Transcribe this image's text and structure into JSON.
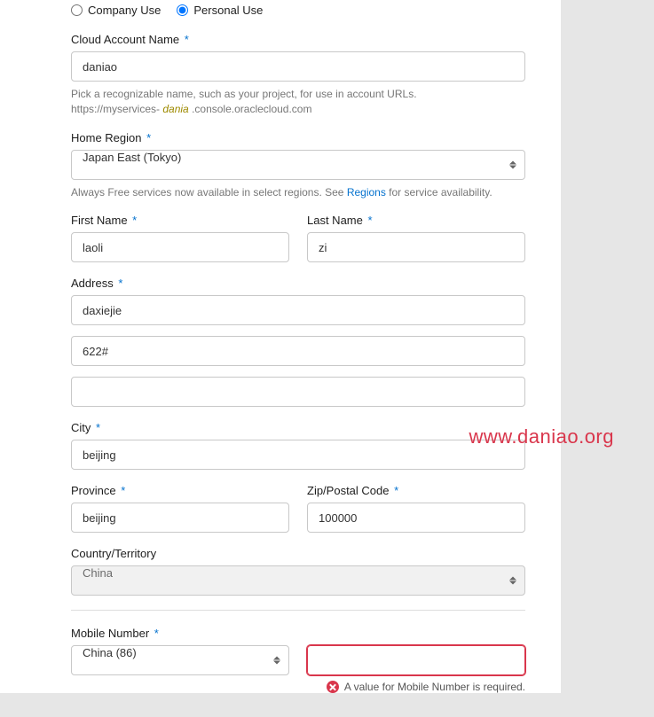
{
  "accountType": {
    "company_label": "Company Use",
    "personal_label": "Personal Use",
    "selected": "personal"
  },
  "cloudAccount": {
    "label": "Cloud Account Name",
    "value": "daniao",
    "help1": "Pick a recognizable name, such as your project, for use in account URLs.",
    "help2_pre": "https://myservices- ",
    "help2_mid": "dania",
    "help2_post": " .console.oraclecloud.com"
  },
  "homeRegion": {
    "label": "Home Region",
    "value": "Japan East (Tokyo)",
    "help_pre": "Always Free services now available in select regions. See ",
    "help_link": "Regions",
    "help_post": " for service availability."
  },
  "firstName": {
    "label": "First Name",
    "value": "laoli"
  },
  "lastName": {
    "label": "Last Name",
    "value": "zi"
  },
  "address": {
    "label": "Address",
    "line1": "daxiejie",
    "line2": "622#",
    "line3": ""
  },
  "city": {
    "label": "City",
    "value": "beijing"
  },
  "province": {
    "label": "Province",
    "value": "beijing"
  },
  "postal": {
    "label": "Zip/Postal Code",
    "value": "100000"
  },
  "country": {
    "label": "Country/Territory",
    "value": "China"
  },
  "mobile": {
    "label": "Mobile Number",
    "code": "China (86)",
    "value": "",
    "error": "A value for Mobile Number is required."
  },
  "watermark": "www.daniao.org"
}
